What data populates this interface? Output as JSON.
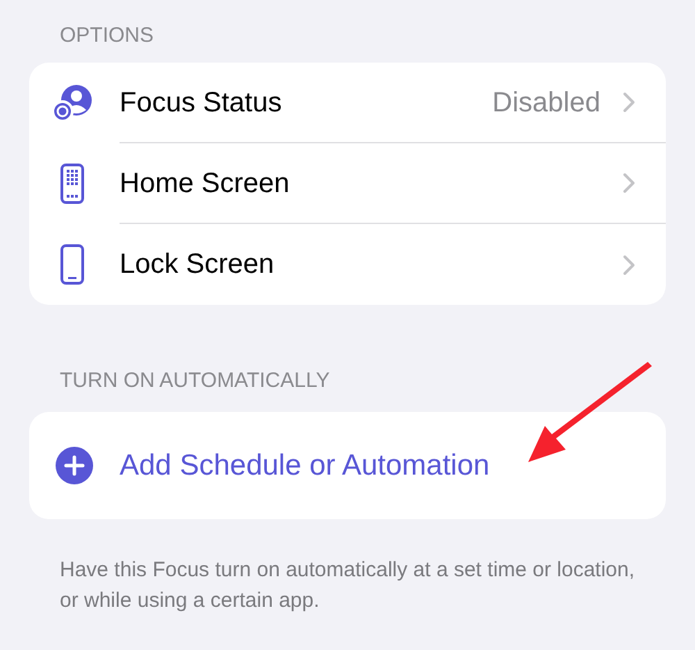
{
  "options": {
    "header": "OPTIONS",
    "rows": [
      {
        "kind": "focus-status",
        "label": "Focus Status",
        "value": "Disabled"
      },
      {
        "kind": "home-screen",
        "label": "Home Screen"
      },
      {
        "kind": "lock-screen",
        "label": "Lock Screen"
      }
    ]
  },
  "automation": {
    "header": "TURN ON AUTOMATICALLY",
    "action": "Add Schedule or Automation",
    "footer": "Have this Focus turn on automatically at a set time or location, or while using a certain app."
  },
  "annotation": {
    "kind": "arrow"
  }
}
